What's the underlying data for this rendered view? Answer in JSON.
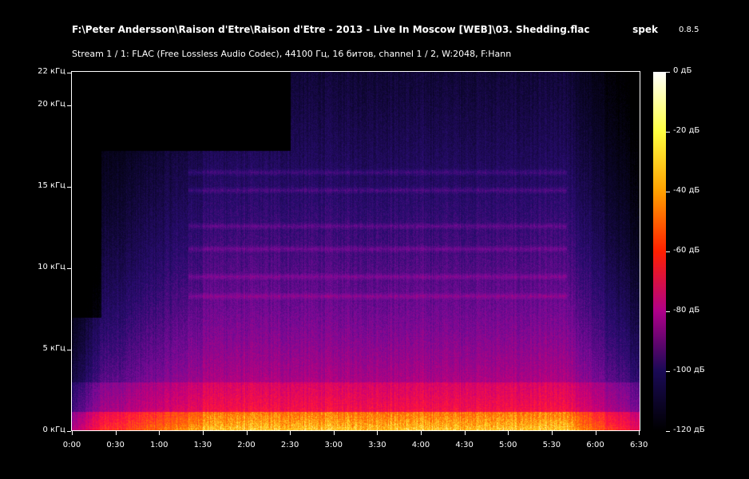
{
  "window": {
    "file_path": "F:\\Peter Andersson\\Raison d'Etre\\Raison d'Etre - 2013 - Live In Moscow [WEB]\\03. Shedding.flac",
    "app_name": "spek",
    "app_version": "0.8.5",
    "stream_info": "Stream 1 / 1: FLAC (Free Lossless Audio Codec), 44100 Гц, 16 битов, channel 1 / 2, W:2048, F:Hann"
  },
  "spectrogram": {
    "y_axis_labels": [
      "0 кГц",
      "5 кГц",
      "10 кГц",
      "15 кГц",
      "20 кГц",
      "22 кГц"
    ],
    "y_axis_values_khz": [
      0,
      5,
      10,
      15,
      20,
      22
    ],
    "y_max_khz": 22.05,
    "x_axis_labels": [
      "0:00",
      "0:30",
      "1:00",
      "1:30",
      "2:00",
      "2:30",
      "3:00",
      "3:30",
      "4:00",
      "4:30",
      "5:00",
      "5:30",
      "6:00",
      "6:30"
    ],
    "x_axis_values_sec": [
      0,
      30,
      60,
      90,
      120,
      150,
      180,
      210,
      240,
      270,
      300,
      330,
      360,
      390
    ],
    "x_max_sec": 391
  },
  "colorbar": {
    "labels": [
      "0 дБ",
      "-20 дБ",
      "-40 дБ",
      "-60 дБ",
      "-80 дБ",
      "-100 дБ",
      "-120 дБ"
    ],
    "values_db": [
      0,
      -20,
      -40,
      -60,
      -80,
      -100,
      -120
    ],
    "colors": [
      "#ffffff",
      "#ffff40",
      "#ffa000",
      "#ff2000",
      "#b0008a",
      "#1a0a55",
      "#000000"
    ]
  }
}
